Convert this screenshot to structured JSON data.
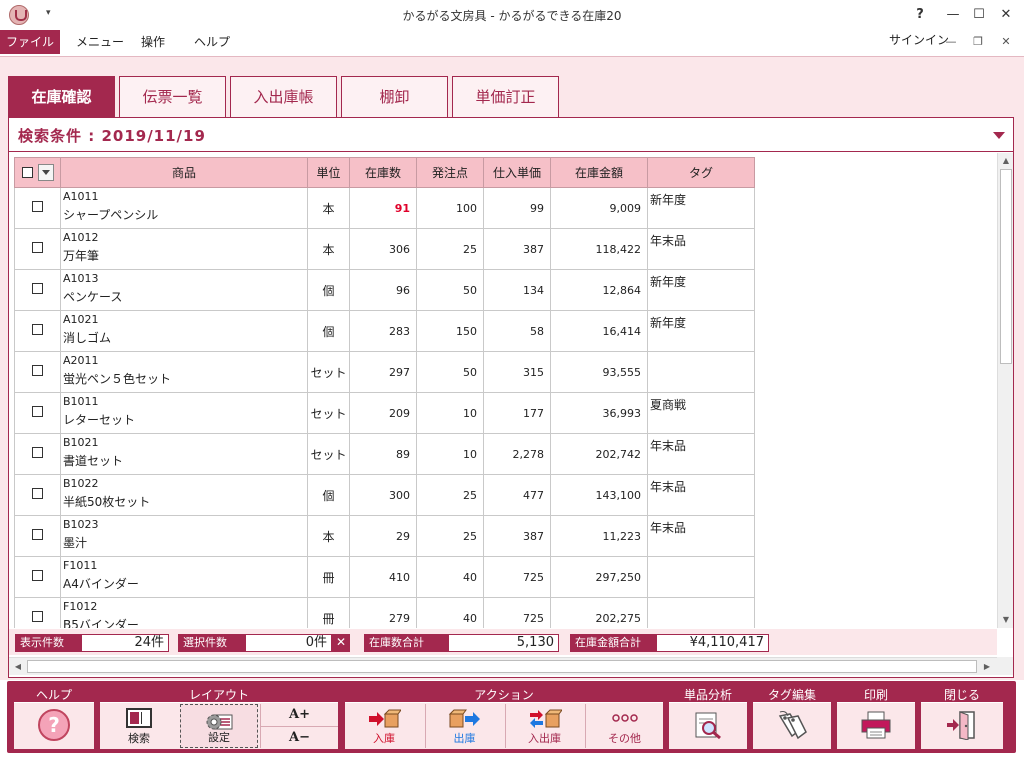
{
  "window": {
    "title": "かるがる文房具 - かるがるできる在庫20",
    "qat_arrow": "▾",
    "help": "?",
    "minimize": "—",
    "maximize": "☐",
    "close": "✕"
  },
  "menu": {
    "items": [
      "ファイル",
      "メニュー",
      "操作",
      "ヘルプ"
    ],
    "signin": "サインイン",
    "sub_min": "—",
    "sub_restore": "❐",
    "sub_close": "✕"
  },
  "tabs": [
    "在庫確認",
    "伝票一覧",
    "入出庫帳",
    "棚卸",
    "単価訂正"
  ],
  "search": {
    "label": "検索条件 : 2019/11/19"
  },
  "grid": {
    "headers": [
      "商品",
      "単位",
      "在庫数",
      "発注点",
      "仕入単価",
      "在庫金額",
      "タグ"
    ],
    "rows": [
      {
        "code": "A1011",
        "name": "シャープペンシル",
        "unit": "本",
        "stock": "91",
        "reorder": "100",
        "price": "99",
        "amount": "9,009",
        "tag": "新年度"
      },
      {
        "code": "A1012",
        "name": "万年筆",
        "unit": "本",
        "stock": "306",
        "reorder": "25",
        "price": "387",
        "amount": "118,422",
        "tag": "年末品"
      },
      {
        "code": "A1013",
        "name": "ペンケース",
        "unit": "個",
        "stock": "96",
        "reorder": "50",
        "price": "134",
        "amount": "12,864",
        "tag": "新年度"
      },
      {
        "code": "A1021",
        "name": "消しゴム",
        "unit": "個",
        "stock": "283",
        "reorder": "150",
        "price": "58",
        "amount": "16,414",
        "tag": "新年度"
      },
      {
        "code": "A2011",
        "name": "蛍光ペン５色セット",
        "unit": "セット",
        "stock": "297",
        "reorder": "50",
        "price": "315",
        "amount": "93,555",
        "tag": ""
      },
      {
        "code": "B1011",
        "name": "レターセット",
        "unit": "セット",
        "stock": "209",
        "reorder": "10",
        "price": "177",
        "amount": "36,993",
        "tag": "夏商戦"
      },
      {
        "code": "B1021",
        "name": "書道セット",
        "unit": "セット",
        "stock": "89",
        "reorder": "10",
        "price": "2,278",
        "amount": "202,742",
        "tag": "年末品"
      },
      {
        "code": "B1022",
        "name": "半紙50枚セット",
        "unit": "個",
        "stock": "300",
        "reorder": "25",
        "price": "477",
        "amount": "143,100",
        "tag": "年末品"
      },
      {
        "code": "B1023",
        "name": "墨汁",
        "unit": "本",
        "stock": "29",
        "reorder": "25",
        "price": "387",
        "amount": "11,223",
        "tag": "年末品"
      },
      {
        "code": "F1011",
        "name": "A4バインダー",
        "unit": "冊",
        "stock": "410",
        "reorder": "40",
        "price": "725",
        "amount": "297,250",
        "tag": ""
      },
      {
        "code": "F1012",
        "name": "B5バインダー",
        "unit": "冊",
        "stock": "279",
        "reorder": "40",
        "price": "725",
        "amount": "202,275",
        "tag": ""
      }
    ]
  },
  "summary": {
    "display_count_label": "表示件数",
    "display_count": "24件",
    "selected_label": "選択件数",
    "selected_count": "0件",
    "clear": "✕",
    "stock_total_label": "在庫数合計",
    "stock_total": "5,130",
    "amount_total_label": "在庫金額合計",
    "amount_total": "¥4,110,417"
  },
  "scroll": {
    "up": "▲",
    "down": "▼",
    "left": "◀",
    "right": "▶"
  },
  "toolbar": {
    "groups": {
      "help": "ヘルプ",
      "layout": "レイアウト",
      "action": "アクション",
      "analysis": "単品分析",
      "tag_edit": "タグ編集",
      "print": "印刷",
      "close": "閉じる"
    },
    "buttons": {
      "search": "検索",
      "settings": "設定",
      "font_up": "A+",
      "font_down": "A−",
      "receive": "入庫",
      "ship": "出庫",
      "in_out": "入出庫",
      "other": "その他"
    },
    "icons": {
      "help": "help-circle-icon",
      "search": "search-layout-icon",
      "settings": "gear-icon",
      "receive": "box-in-icon",
      "ship": "box-out-icon",
      "in_out": "box-transfer-icon",
      "other": "more-dots-icon",
      "analysis": "magnifier-chart-icon",
      "tag_edit": "tag-icon",
      "print": "printer-icon",
      "close": "exit-door-icon"
    }
  },
  "colors": {
    "accent": "#a3284e",
    "pink_bg": "#fbe7ea",
    "header_bg": "#f6c0c8",
    "low_stock": "#e0002a",
    "in_arrow": "#d0102c",
    "out_arrow": "#1e78e0"
  }
}
